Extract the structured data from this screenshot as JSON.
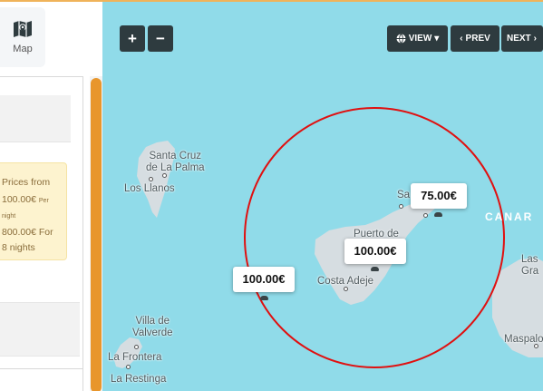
{
  "sidebar": {
    "map_tab_label": "Map",
    "price": {
      "line1": "Prices from",
      "amount_from": "100.00€",
      "per": "Per",
      "night": "night",
      "total": "800.00€ For",
      "nights": "8 nights"
    }
  },
  "map_controls": {
    "zoom_in": "+",
    "zoom_out": "−",
    "view_label": "VIEW",
    "prev_label": "PREV",
    "next_label": "NEXT"
  },
  "markers": [
    {
      "price": "75.00€"
    },
    {
      "price": "100.00€"
    },
    {
      "price": "100.00€"
    }
  ],
  "places": {
    "santa_cruz_la_palma_1": "Santa Cruz",
    "santa_cruz_la_palma_2": "de La Palma",
    "los_llanos": "Los Llanos",
    "villa_de_valverde_1": "Villa de",
    "villa_de_valverde_2": "Valverde",
    "la_frontera": "La Frontera",
    "la_restinga": "La Restinga",
    "puerto_de": "Puerto de",
    "costa_adeje": "Costa Adeje",
    "santa_cruz_tenerife": "Sa",
    "las_palmas_1": "Las",
    "las_palmas_2": "Gra",
    "maspalomas": "Maspalo",
    "canarias": "CANAR"
  },
  "colors": {
    "sea": "#90dbe9",
    "land": "#d6dde1",
    "circle": "#e01010",
    "button": "#2e3b3f",
    "scrollbar": "#e8962c",
    "price_box": "#fdf3cf"
  }
}
